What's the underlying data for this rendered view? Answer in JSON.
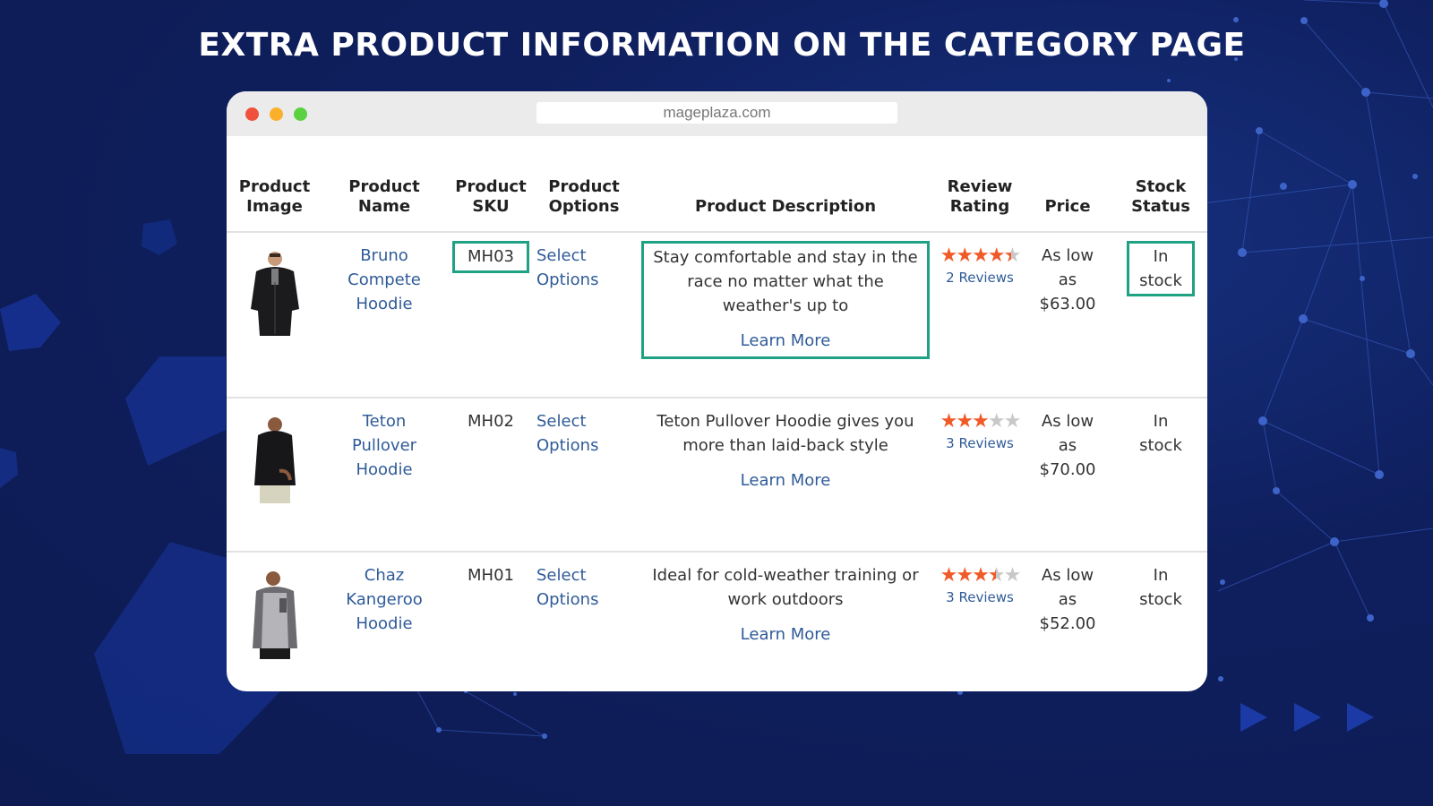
{
  "page": {
    "title": "EXTRA PRODUCT INFORMATION ON THE CATEGORY PAGE"
  },
  "browser": {
    "url": "mageplaza.com"
  },
  "colors": {
    "background": "#0f1f5e",
    "highlight_border": "#1fa183",
    "link": "#2f5b98",
    "star_filled": "#f05a28",
    "star_empty": "#c8c8c8"
  },
  "table": {
    "headers": {
      "image": [
        "Product",
        "Image"
      ],
      "name": [
        "Product",
        "Name"
      ],
      "sku": [
        "Product",
        "SKU"
      ],
      "options": [
        "Product",
        "Options"
      ],
      "description": "Product Description",
      "rating": [
        "Review",
        "Rating"
      ],
      "price": "Price",
      "stock": [
        "Stock",
        "Status"
      ]
    },
    "rows": [
      {
        "image_icon": "hoodie-black-zip-icon",
        "name": [
          "Bruno",
          "Compete",
          "Hoodie"
        ],
        "sku": "MH03",
        "options": [
          "Select",
          "Options"
        ],
        "description": "Stay comfortable and stay in the race no matter what the weather's up to",
        "learn_more": "Learn More",
        "rating": 4.5,
        "reviews": "2 Reviews",
        "price": [
          "As low",
          "as",
          "$63.00"
        ],
        "stock": [
          "In",
          "stock"
        ]
      },
      {
        "image_icon": "hoodie-black-pullover-icon",
        "name": [
          "Teton",
          "Pullover",
          "Hoodie"
        ],
        "sku": "MH02",
        "options": [
          "Select",
          "Options"
        ],
        "description": "Teton Pullover Hoodie gives you more than laid-back style",
        "learn_more": "Learn More",
        "rating": 3,
        "reviews": "3 Reviews",
        "price": [
          "As low",
          "as",
          "$70.00"
        ],
        "stock": [
          "In",
          "stock"
        ]
      },
      {
        "image_icon": "hoodie-grey-kangaroo-icon",
        "name": [
          "Chaz",
          "Kangeroo",
          "Hoodie"
        ],
        "sku": "MH01",
        "options": [
          "Select",
          "Options"
        ],
        "description": "Ideal for cold-weather training or work outdoors",
        "learn_more": "Learn More",
        "rating": 3.5,
        "reviews": "3 Reviews",
        "price": [
          "As low",
          "as",
          "$52.00"
        ],
        "stock": [
          "In",
          "stock"
        ]
      }
    ]
  }
}
